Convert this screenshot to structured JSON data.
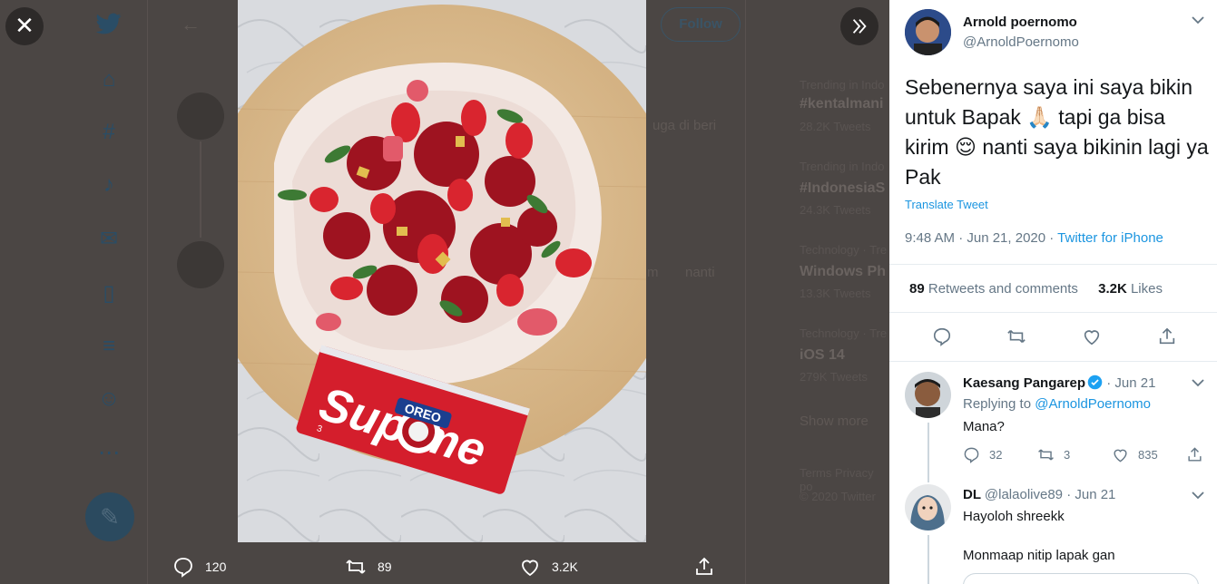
{
  "background": {
    "follow_label": "Follow",
    "trends": [
      {
        "context": "Trending in Indo",
        "name": "#kentalmani",
        "count": "28.2K Tweets"
      },
      {
        "context": "Trending in Indo",
        "name": "#IndonesiaS",
        "count": "24.3K Tweets"
      },
      {
        "context": "Technology · Tre",
        "name": "Windows Ph",
        "count": "13.3K Tweets"
      },
      {
        "context": "Technology · Tre",
        "name": "iOS 14",
        "count": "279K Tweets"
      }
    ],
    "show_more": "Show more",
    "footer_links": "Terms  Privacy po",
    "footer_copy": "© 2020 Twitter",
    "snippet_1": "uga di beri",
    "snippet_2": "m",
    "snippet_3": "nanti"
  },
  "media": {
    "close_label": "✕",
    "expand_label": "»",
    "actions": {
      "replies": "120",
      "retweets": "89",
      "likes": "3.2K"
    }
  },
  "tweet": {
    "author_name": "Arnold poernomo",
    "author_handle": "@ArnoldPoernomo",
    "text_parts": [
      "Sebenernya saya ini saya bikin untuk Bapak",
      "tapi ga bisa kirim",
      "nanti saya bikinin lagi ya Pak"
    ],
    "emoji_1": "🙏🏻",
    "emoji_2": "😌",
    "translate": "Translate Tweet",
    "time": "9:48 AM · Jun 21, 2020 · ",
    "source": "Twitter for iPhone",
    "retweets_count": "89",
    "retweets_label": "Retweets and comments",
    "likes_count": "3.2K",
    "likes_label": "Likes"
  },
  "replies": [
    {
      "name": "Kaesang Pangarep",
      "meta": " · Jun 21",
      "replying_prefix": "Replying to ",
      "replying_to": "@ArnoldPoernomo",
      "text": "Mana?",
      "reply_count": "32",
      "retweet_count": "3",
      "like_count": "835"
    },
    {
      "name": "DL",
      "handle": "@lalaolive89",
      "meta": " · Jun 21",
      "text": "Hayoloh shreekk",
      "text_2": "Monmaap nitip lapak gan"
    }
  ],
  "photo_text": {
    "brand": "Supreme",
    "product": "OREO",
    "pack": "3"
  },
  "colors": {
    "accent": "#1b95e0",
    "overlay": "#4a4543",
    "text_dark": "#14171a",
    "text_muted": "#657786"
  }
}
